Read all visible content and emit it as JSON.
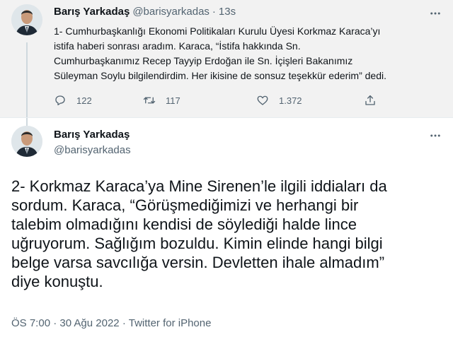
{
  "tweet1": {
    "name": "Barış Yarkadaş",
    "handle": "@barisyarkadas",
    "dot": "·",
    "time": "13s",
    "lines": [
      "1- Cumhurbaşkanlığı Ekonomi Politikaları Kurulu Üyesi Korkmaz Karaca’yı",
      "istifa haberi sonrası aradım. Karaca, “İstifa hakkında Sn.",
      "Cumhurbaşkanımız Recep Tayyip Erdoğan ile Sn. İçişleri Bakanımız",
      "Süleyman Soylu bilgilendirdim. Her ikisine de sonsuz teşekkür ederim” dedi."
    ],
    "actions": {
      "reply_count": "122",
      "retweet_count": "117",
      "like_count": "1.372"
    }
  },
  "tweet2": {
    "name": "Barış Yarkadaş",
    "handle": "@barisyarkadas",
    "lines": [
      "2- Korkmaz Karaca’ya Mine Sirenen’le ilgili iddiaları da",
      "sordum. Karaca, “Görüşmediğimizi ve herhangi bir",
      "talebim olmadığını kendisi de söylediği halde lince",
      "uğruyorum. Sağlığım bozuldu. Kimin elinde hangi bilgi",
      "belge varsa savcılığa versin. Devletten ihale almadım”",
      "diye konuştu."
    ],
    "time": "ÖS 7:00",
    "date": "30 Ağu 2022",
    "source": "Twitter for iPhone",
    "sep": "·"
  },
  "colors": {
    "text": "#0f1419",
    "secondary": "#536471",
    "parent_background": "#f2f2f2",
    "thread_line": "#cfd9de"
  },
  "icons": [
    "more-icon",
    "reply-icon",
    "retweet-icon",
    "like-icon",
    "share-icon"
  ]
}
